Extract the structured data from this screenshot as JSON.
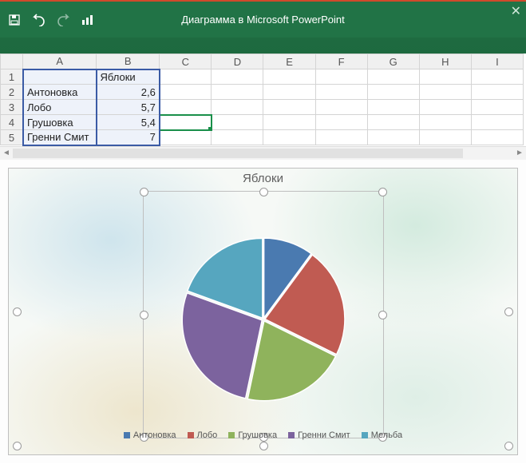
{
  "titlebar": {
    "title": "Диаграмма в Microsoft PowerPoint"
  },
  "columns": [
    "A",
    "B",
    "C",
    "D",
    "E",
    "F",
    "G",
    "H",
    "I"
  ],
  "sheet": {
    "headerB": "Яблоки",
    "rows": [
      {
        "n": "2",
        "a": "Антоновка",
        "b": "2,6"
      },
      {
        "n": "3",
        "a": "Лобо",
        "b": "5,7"
      },
      {
        "n": "4",
        "a": "Грушовка",
        "b": "5,4"
      },
      {
        "n": "5",
        "a": "Гренни Смит",
        "b": "7"
      }
    ]
  },
  "chart_data": {
    "type": "pie",
    "title": "Яблоки",
    "categories": [
      "Антоновка",
      "Лобо",
      "Грушовка",
      "Гренни Смит",
      "Мельба"
    ],
    "values": [
      2.6,
      5.7,
      5.4,
      7,
      5
    ],
    "colors": [
      "#4a7ab0",
      "#c05b52",
      "#8fb35c",
      "#7c639e",
      "#56a6bf"
    ]
  }
}
